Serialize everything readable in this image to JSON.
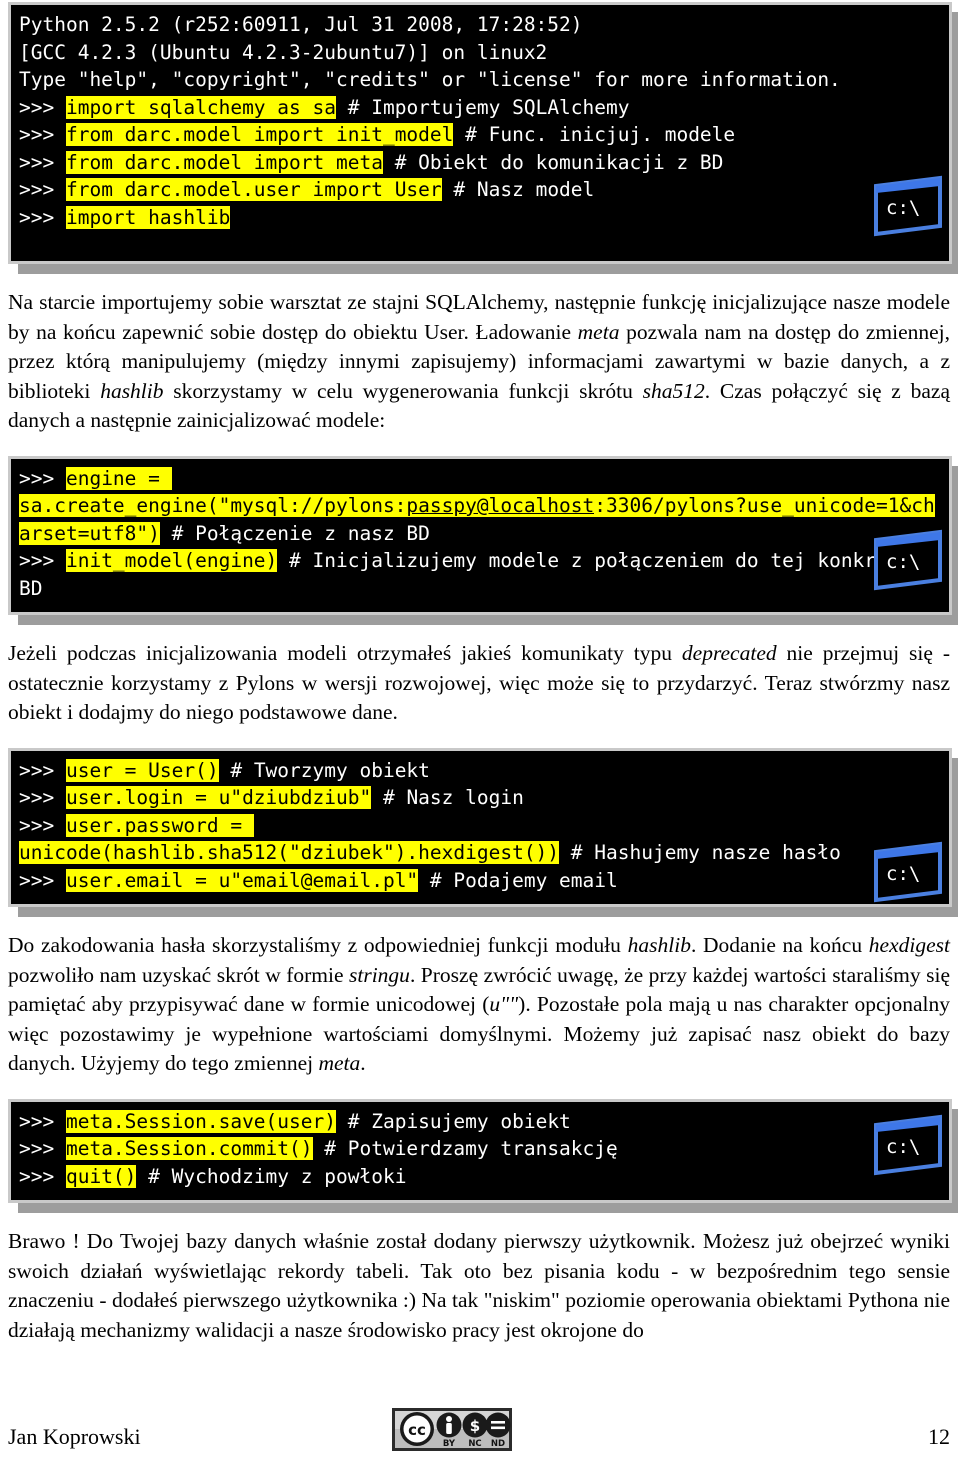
{
  "document": {
    "language": "pl",
    "page_number": "12",
    "author": "Jan Koprowski",
    "license_badge": "cc-by-nc-nd"
  },
  "terminals": [
    {
      "name": "terminal-python-imports",
      "icon": "c:\\",
      "lines": [
        {
          "segments": [
            {
              "text": "Python 2.5.2 (r252:60911, Jul 31 2008, 17:28:52)",
              "style": "plain"
            }
          ]
        },
        {
          "segments": [
            {
              "text": "[GCC 4.2.3 (Ubuntu 4.2.3-2ubuntu7)] on linux2",
              "style": "plain"
            }
          ]
        },
        {
          "segments": [
            {
              "text": "Type \"help\", \"copyright\", \"credits\" or \"license\" for more information.",
              "style": "plain"
            }
          ]
        },
        {
          "segments": [
            {
              "text": ">>> ",
              "style": "prompt"
            },
            {
              "text": "import sqlalchemy as sa",
              "style": "highlight"
            },
            {
              "text": " # Importujemy SQLAlchemy",
              "style": "plain"
            }
          ]
        },
        {
          "segments": [
            {
              "text": ">>> ",
              "style": "prompt"
            },
            {
              "text": "from darc.model import init_model",
              "style": "highlight"
            },
            {
              "text": " # Func. inicjuj. modele",
              "style": "plain"
            }
          ]
        },
        {
          "segments": [
            {
              "text": ">>> ",
              "style": "prompt"
            },
            {
              "text": "from darc.model import meta",
              "style": "highlight"
            },
            {
              "text": " # Obiekt do komunikacji z BD",
              "style": "plain"
            }
          ]
        },
        {
          "segments": [
            {
              "text": ">>> ",
              "style": "prompt"
            },
            {
              "text": "from darc.model.user import User",
              "style": "highlight"
            },
            {
              "text": " # Nasz model",
              "style": "plain"
            }
          ]
        },
        {
          "segments": [
            {
              "text": ">>> ",
              "style": "prompt"
            },
            {
              "text": "import hashlib",
              "style": "highlight"
            }
          ]
        }
      ]
    },
    {
      "name": "terminal-engine-init",
      "icon": "c:\\",
      "lines": [
        {
          "segments": [
            {
              "text": ">>> ",
              "style": "prompt"
            },
            {
              "text": "engine = ",
              "style": "highlight"
            }
          ]
        },
        {
          "segments": [
            {
              "text": "sa.create_engine(\"mysql://pylons:",
              "style": "highlight"
            },
            {
              "text": "passpy@localhost",
              "style": "highlight-underline"
            },
            {
              "text": ":3306/pylons?use_unicode=1&charset=utf8\")",
              "style": "highlight"
            },
            {
              "text": " # Połączenie z nasz BD",
              "style": "plain"
            }
          ]
        },
        {
          "segments": [
            {
              "text": ">>> ",
              "style": "prompt"
            },
            {
              "text": "init_model(engine)",
              "style": "highlight"
            },
            {
              "text": " # Inicjalizujemy modele z połączeniem do tej konkretnej BD",
              "style": "plain"
            }
          ]
        }
      ]
    },
    {
      "name": "terminal-create-user",
      "icon": "c:\\",
      "lines": [
        {
          "segments": [
            {
              "text": ">>> ",
              "style": "prompt"
            },
            {
              "text": "user = User()",
              "style": "highlight"
            },
            {
              "text": " # Tworzymy obiekt",
              "style": "plain"
            }
          ]
        },
        {
          "segments": [
            {
              "text": ">>> ",
              "style": "prompt"
            },
            {
              "text": "user.login = u\"dziubdziub\"",
              "style": "highlight"
            },
            {
              "text": " # Nasz login",
              "style": "plain"
            }
          ]
        },
        {
          "segments": [
            {
              "text": ">>> ",
              "style": "prompt"
            },
            {
              "text": "user.password = ",
              "style": "highlight"
            }
          ]
        },
        {
          "segments": [
            {
              "text": "unicode(hashlib.sha512(\"dziubek\").hexdigest())",
              "style": "highlight"
            },
            {
              "text": " # Hashujemy nasze hasło",
              "style": "plain"
            }
          ]
        },
        {
          "segments": [
            {
              "text": ">>> ",
              "style": "prompt"
            },
            {
              "text": "user.email = u\"email@email.pl\"",
              "style": "highlight"
            },
            {
              "text": " # Podajemy email",
              "style": "plain"
            }
          ]
        }
      ]
    },
    {
      "name": "terminal-save-commit-quit",
      "icon": "c:\\",
      "lines": [
        {
          "segments": [
            {
              "text": ">>> ",
              "style": "prompt"
            },
            {
              "text": "meta.Session.save(user)",
              "style": "highlight"
            },
            {
              "text": " # Zapisujemy obiekt",
              "style": "plain"
            }
          ]
        },
        {
          "segments": [
            {
              "text": ">>> ",
              "style": "prompt"
            },
            {
              "text": "meta.Session.commit()",
              "style": "highlight"
            },
            {
              "text": " # Potwierdzamy transakcję",
              "style": "plain"
            }
          ]
        },
        {
          "segments": [
            {
              "text": ">>> ",
              "style": "prompt"
            },
            {
              "text": "quit()",
              "style": "highlight"
            },
            {
              "text": " # Wychodzimy z powłoki",
              "style": "plain"
            }
          ]
        }
      ]
    }
  ],
  "paragraphs": [
    {
      "name": "paragraph-imports-explanation",
      "runs": [
        {
          "text": "Na starcie importujemy sobie warsztat ze stajni SQLAlchemy, następnie funkcję inicjalizujące nasze modele by na końcu zapewnić sobie dostęp do obiektu User. Ładowanie ",
          "style": "normal"
        },
        {
          "text": "meta",
          "style": "italic"
        },
        {
          "text": " pozwala nam na dostęp do zmiennej, przez którą manipulujemy (między innymi zapisujemy) informacjami zawartymi w bazie danych, a z biblioteki ",
          "style": "normal"
        },
        {
          "text": "hashlib",
          "style": "italic"
        },
        {
          "text": " skorzystamy w celu wygenerowania funkcji skrótu ",
          "style": "normal"
        },
        {
          "text": "sha512",
          "style": "italic"
        },
        {
          "text": ". Czas połączyć się z bazą danych a następnie zainicjalizować modele:",
          "style": "normal"
        }
      ]
    },
    {
      "name": "paragraph-deprecated-note",
      "runs": [
        {
          "text": "Jeżeli podczas inicjalizowania modeli otrzymałeś jakieś komunikaty typu ",
          "style": "normal"
        },
        {
          "text": "deprecated",
          "style": "italic"
        },
        {
          "text": " nie przejmuj się - ostatecznie korzystamy z Pylons w wersji rozwojowej, więc może się to przydarzyć. Teraz stwórzmy nasz obiekt i dodajmy do niego podstawowe dane.",
          "style": "normal"
        }
      ]
    },
    {
      "name": "paragraph-hashlib-explanation",
      "runs": [
        {
          "text": "Do zakodowania hasła skorzystaliśmy z odpowiedniej funkcji modułu ",
          "style": "normal"
        },
        {
          "text": "hashlib",
          "style": "italic"
        },
        {
          "text": ". Dodanie na końcu ",
          "style": "normal"
        },
        {
          "text": "hexdigest",
          "style": "italic"
        },
        {
          "text": " pozwoliło nam uzyskać skrót w formie ",
          "style": "normal"
        },
        {
          "text": "stringu",
          "style": "italic"
        },
        {
          "text": ". Proszę zwrócić uwagę, że przy każdej wartości staraliśmy się pamiętać aby przypisywać dane w formie unicodowej (",
          "style": "normal"
        },
        {
          "text": "u\"\"",
          "style": "italic"
        },
        {
          "text": "). Pozostałe pola mają u nas charakter opcjonalny więc pozostawimy je wypełnione wartościami domyślnymi. Możemy już zapisać nasz obiekt do bazy danych. Użyjemy do tego zmiennej ",
          "style": "normal"
        },
        {
          "text": "meta",
          "style": "italic"
        },
        {
          "text": ".",
          "style": "normal"
        }
      ]
    },
    {
      "name": "paragraph-conclusion",
      "runs": [
        {
          "text": "Brawo ! Do Twojej bazy danych właśnie został dodany pierwszy użytkownik. Możesz już obejrzeć wyniki swoich działań wyświetlając rekordy tabeli. Tak oto bez pisania kodu - w bezpośrednim tego sensie znaczeniu - dodałeś pierwszego użytkownika :) Na tak \"niskim\" poziomie operowania obiektami Pythona nie działają mechanizmy walidacji a nasze środowisko pracy jest okrojone do",
          "style": "normal"
        }
      ]
    }
  ],
  "colors": {
    "highlight_bg": "#ffff00",
    "terminal_bg": "#000000",
    "terminal_fg": "#ffffff",
    "frame": "#c9c9c9",
    "shadow": "#9d9d9d"
  }
}
